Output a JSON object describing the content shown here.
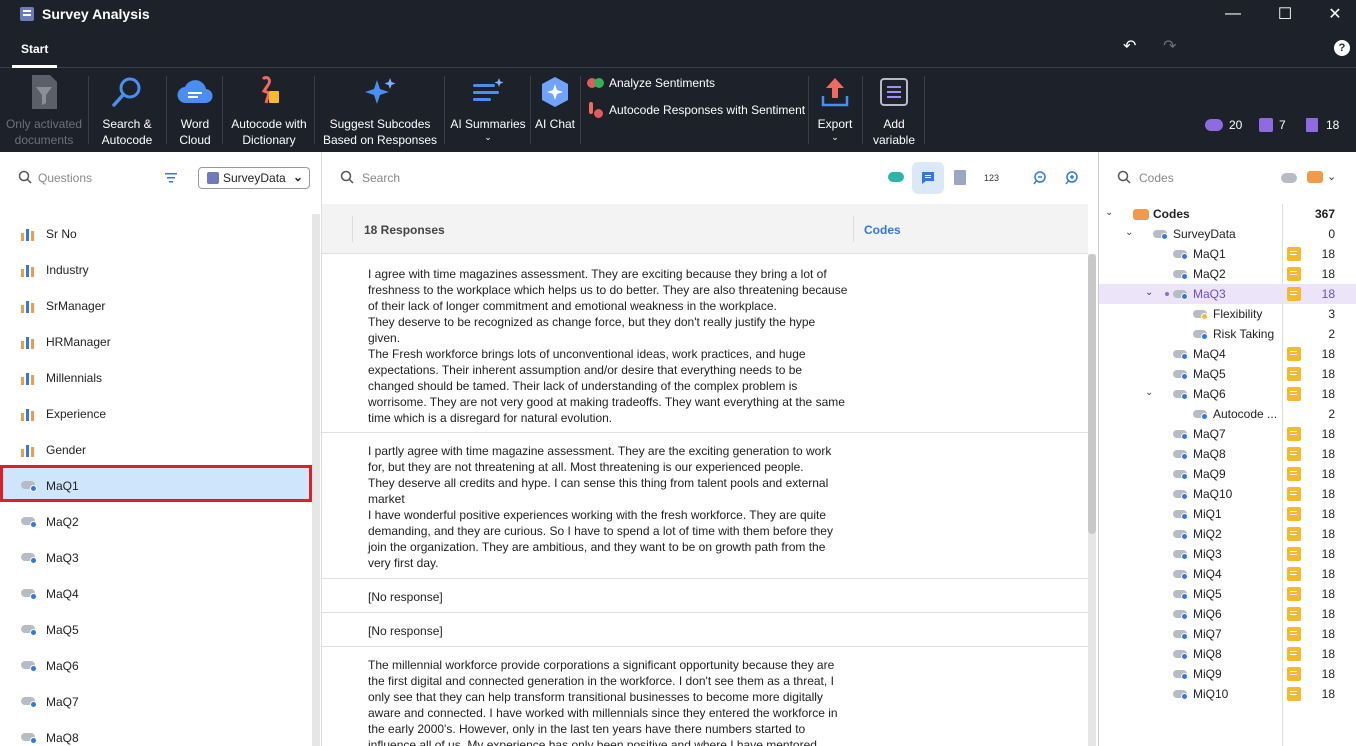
{
  "window": {
    "title": "Survey Analysis",
    "minimize": "—",
    "maximize": "☐",
    "close": "✕"
  },
  "tabs": [
    {
      "label": "Start"
    }
  ],
  "ribbon": {
    "only_activated": "Only activated documents",
    "search_autocode": "Search & Autocode",
    "word_cloud": "Word Cloud",
    "autocode_dictionary": "Autocode with Dictionary",
    "suggest_subcodes": "Suggest Subcodes Based on Responses",
    "ai_summaries": "AI Summaries",
    "ai_chat": "AI Chat",
    "analyze_sentiments": "Analyze Sentiments",
    "autocode_sentiment": "Autocode Responses with Sentiment",
    "export": "Export",
    "add_variable": "Add variable",
    "stats": {
      "codes": "20",
      "memos": "7",
      "documents": "18"
    }
  },
  "left": {
    "search_placeholder": "Questions",
    "dataset": "SurveyData",
    "questions": [
      {
        "label": "Sr No",
        "type": "variable"
      },
      {
        "label": "Industry",
        "type": "variable"
      },
      {
        "label": "SrManager",
        "type": "variable"
      },
      {
        "label": "HRManager",
        "type": "variable"
      },
      {
        "label": "Millennials",
        "type": "variable"
      },
      {
        "label": "Experience",
        "type": "variable"
      },
      {
        "label": "Gender",
        "type": "variable"
      },
      {
        "label": "MaQ1",
        "type": "code"
      },
      {
        "label": "MaQ2",
        "type": "code"
      },
      {
        "label": "MaQ3",
        "type": "code"
      },
      {
        "label": "MaQ4",
        "type": "code"
      },
      {
        "label": "MaQ5",
        "type": "code"
      },
      {
        "label": "MaQ6",
        "type": "code"
      },
      {
        "label": "MaQ7",
        "type": "code"
      },
      {
        "label": "MaQ8",
        "type": "code"
      }
    ]
  },
  "middle": {
    "search_placeholder": "Search",
    "toolbar_num": "123",
    "col_responses": "18 Responses",
    "col_codes": "Codes",
    "responses": [
      "I agree with time magazines assessment.  They are exciting because they bring a lot of freshness to the workplace which helps us to do better. They are also threatening because of their lack of longer commitment and emotional weakness in the workplace.\nThey deserve to be recognized as change force, but they don't really justify the hype given.\nThe Fresh workforce brings lots of unconventional ideas, work practices, and huge expectations. Their inherent assumption and/or desire that everything needs to be changed should be tamed. Their lack of understanding of the complex problem is worrisome. They are not very good at making tradeoffs. They want everything at the same time which is a disregard for natural evolution.",
      "I partly agree with time magazine assessment. They are the exciting generation to work for, but they are not threatening at all. Most threatening is our experienced people.\nThey deserve all credits and hype. I can sense this thing from talent pools and external market\nI have wonderful positive experiences working with the fresh workforce. They are quite demanding, and they are curious. So I have to spend a lot of time with them before they join the organization. They are ambitious, and they want to be on growth path from the very first day.",
      "[No response]",
      "[No response]",
      "The millennial workforce provide corporations a significant opportunity because they are the first digital and connected generation in the workforce. I don't see them as a threat, I only see that they can help transform transitional businesses to become more digitally aware and connected.  I have worked with millennials since they entered the workforce in the early 2000's. However, only in the last ten years have there numbers started to influence all of us.  My experience has only been positive and where I have mentored"
    ]
  },
  "right": {
    "search_placeholder": "Codes",
    "tree": [
      {
        "label": "Codes",
        "count": "367",
        "level": 0,
        "bold": true,
        "chev": "v",
        "memo": false,
        "root": true
      },
      {
        "label": "SurveyData",
        "count": "0",
        "level": 1,
        "chev": "v",
        "memo": false
      },
      {
        "label": "MaQ1",
        "count": "18",
        "level": 2,
        "memo": true
      },
      {
        "label": "MaQ2",
        "count": "18",
        "level": 2,
        "memo": true
      },
      {
        "label": "MaQ3",
        "count": "18",
        "level": 2,
        "chev": "v",
        "memo": true,
        "selected": true
      },
      {
        "label": "Flexibility",
        "count": "3",
        "level": 3,
        "memo": false,
        "yellow": true
      },
      {
        "label": "Risk Taking",
        "count": "2",
        "level": 3,
        "memo": false
      },
      {
        "label": "MaQ4",
        "count": "18",
        "level": 2,
        "memo": true
      },
      {
        "label": "MaQ5",
        "count": "18",
        "level": 2,
        "memo": true
      },
      {
        "label": "MaQ6",
        "count": "18",
        "level": 2,
        "chev": "v",
        "memo": true
      },
      {
        "label": "Autocode ...",
        "count": "2",
        "level": 3,
        "memo": false
      },
      {
        "label": "MaQ7",
        "count": "18",
        "level": 2,
        "memo": true
      },
      {
        "label": "MaQ8",
        "count": "18",
        "level": 2,
        "memo": true
      },
      {
        "label": "MaQ9",
        "count": "18",
        "level": 2,
        "memo": true
      },
      {
        "label": "MaQ10",
        "count": "18",
        "level": 2,
        "memo": true
      },
      {
        "label": "MiQ1",
        "count": "18",
        "level": 2,
        "memo": true
      },
      {
        "label": "MiQ2",
        "count": "18",
        "level": 2,
        "memo": true
      },
      {
        "label": "MiQ3",
        "count": "18",
        "level": 2,
        "memo": true
      },
      {
        "label": "MiQ4",
        "count": "18",
        "level": 2,
        "memo": true
      },
      {
        "label": "MiQ5",
        "count": "18",
        "level": 2,
        "memo": true
      },
      {
        "label": "MiQ6",
        "count": "18",
        "level": 2,
        "memo": true
      },
      {
        "label": "MiQ7",
        "count": "18",
        "level": 2,
        "memo": true
      },
      {
        "label": "MiQ8",
        "count": "18",
        "level": 2,
        "memo": true
      },
      {
        "label": "MiQ9",
        "count": "18",
        "level": 2,
        "memo": true
      },
      {
        "label": "MiQ10",
        "count": "18",
        "level": 2,
        "memo": true
      }
    ]
  },
  "colors": {
    "accent": "#2f78e6",
    "selection": "#cfe5fb",
    "highlight_box": "#e21d25",
    "dark": "#1d2129",
    "memo": "#f5b82e"
  }
}
